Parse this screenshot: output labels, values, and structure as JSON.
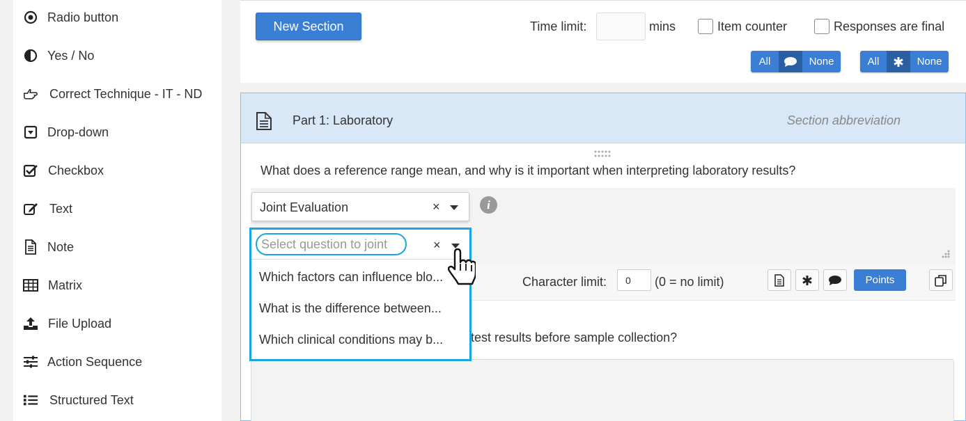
{
  "sidebar": {
    "items": [
      {
        "label": "Radio button",
        "icon": "radio-dot-icon"
      },
      {
        "label": "Yes / No",
        "icon": "half-circle-icon"
      },
      {
        "label": "Correct Technique - IT - ND",
        "icon": "hand-pointer-icon"
      },
      {
        "label": "Drop-down",
        "icon": "dropdown-square-icon"
      },
      {
        "label": "Checkbox",
        "icon": "check-square-icon"
      },
      {
        "label": "Text",
        "icon": "edit-icon"
      },
      {
        "label": "Note",
        "icon": "document-icon"
      },
      {
        "label": "Matrix",
        "icon": "table-icon"
      },
      {
        "label": "File Upload",
        "icon": "upload-icon"
      },
      {
        "label": "Action Sequence",
        "icon": "sliders-icon"
      },
      {
        "label": "Structured Text",
        "icon": "list-icon"
      }
    ]
  },
  "topbar": {
    "new_section_label": "New Section",
    "time_limit_label": "Time limit:",
    "time_limit_value": "",
    "time_unit": "mins",
    "item_counter_label": "Item counter",
    "responses_final_label": "Responses are final",
    "comment_toggle": {
      "all": "All",
      "none": "None"
    },
    "required_toggle": {
      "all": "All",
      "none": "None"
    }
  },
  "section": {
    "title": "Part 1: Laboratory",
    "abbreviation_placeholder": "Section abbreviation",
    "question1": "What does a reference range mean, and why is it important when interpreting laboratory results?",
    "evaluation_select": "Joint Evaluation",
    "clear_symbol": "×",
    "info_symbol": "i",
    "character_limit_label": "Character limit:",
    "character_limit_value": "0",
    "character_limit_hint": "(0 = no limit)",
    "points_label": "Points",
    "question2_visible": "test results before sample collection?"
  },
  "dropdown": {
    "placeholder": "Select question to joint",
    "clear_symbol": "×",
    "options": [
      "Which factors can influence blo...",
      "What is the difference between...",
      "Which clinical conditions may b..."
    ]
  },
  "colors": {
    "primary": "#3a7fd5",
    "primary_dark": "#2a5fa3",
    "highlight": "#1ba4e0",
    "section_header": "#d8e8f7"
  }
}
